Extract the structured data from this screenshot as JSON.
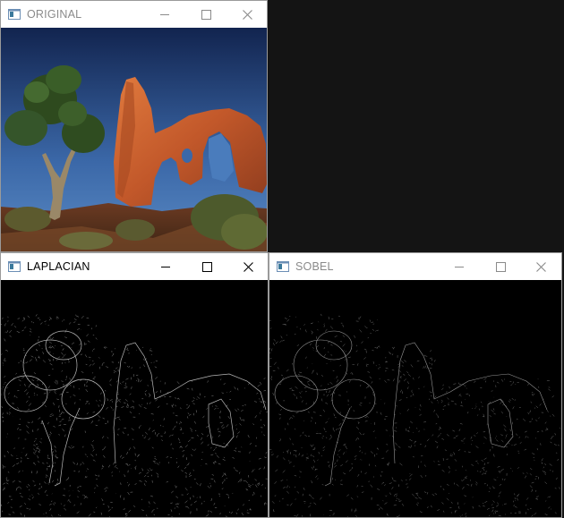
{
  "windows": {
    "original": {
      "title": "ORIGINAL",
      "icon": "app-window-icon",
      "state": "inactive"
    },
    "laplacian": {
      "title": "LAPLACIAN",
      "icon": "app-window-icon",
      "state": "active"
    },
    "sobel": {
      "title": "SOBEL",
      "icon": "app-window-icon",
      "state": "inactive"
    }
  },
  "controls": {
    "minimize": "minimize-icon",
    "maximize": "maximize-icon",
    "close": "close-icon"
  },
  "colors": {
    "desktop": "#141414",
    "sky_top": "#14285a",
    "sky_bottom": "#4a78b8",
    "rock": "#c4602e",
    "edge_background": "#000000"
  }
}
